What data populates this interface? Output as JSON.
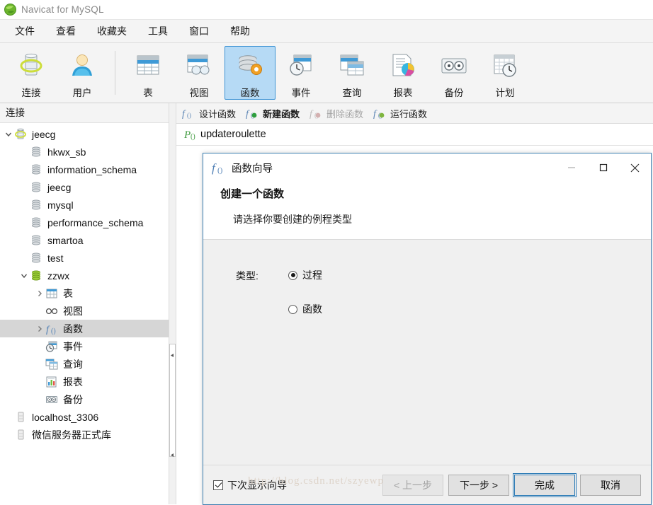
{
  "window": {
    "title": "Navicat for MySQL",
    "logo_icon": "navicat-globe-icon"
  },
  "menubar": {
    "items": [
      {
        "label": "文件",
        "name": "menu-file"
      },
      {
        "label": "查看",
        "name": "menu-view"
      },
      {
        "label": "收藏夹",
        "name": "menu-favorites"
      },
      {
        "label": "工具",
        "name": "menu-tools"
      },
      {
        "label": "窗口",
        "name": "menu-window"
      },
      {
        "label": "帮助",
        "name": "menu-help"
      }
    ]
  },
  "toolbar": {
    "buttons": [
      {
        "label": "连接",
        "icon": "connection-icon",
        "active": false
      },
      {
        "label": "用户",
        "icon": "user-icon",
        "active": false
      },
      {
        "label": "表",
        "icon": "table-icon",
        "active": false
      },
      {
        "label": "视图",
        "icon": "view-icon",
        "active": false
      },
      {
        "label": "函数",
        "icon": "function-icon",
        "active": true
      },
      {
        "label": "事件",
        "icon": "event-icon",
        "active": false
      },
      {
        "label": "查询",
        "icon": "query-icon",
        "active": false
      },
      {
        "label": "报表",
        "icon": "report-icon",
        "active": false
      },
      {
        "label": "备份",
        "icon": "backup-icon",
        "active": false
      },
      {
        "label": "计划",
        "icon": "schedule-icon",
        "active": false
      }
    ]
  },
  "sidebar": {
    "header": "连接",
    "tree": [
      {
        "label": "jeecg",
        "icon": "connection-icon",
        "indent": 0,
        "chevron": "down",
        "selected": false
      },
      {
        "label": "hkwx_sb",
        "icon": "database-icon",
        "indent": 1,
        "chevron": "",
        "selected": false
      },
      {
        "label": "information_schema",
        "icon": "database-icon",
        "indent": 1,
        "chevron": "",
        "selected": false
      },
      {
        "label": "jeecg",
        "icon": "database-icon",
        "indent": 1,
        "chevron": "",
        "selected": false
      },
      {
        "label": "mysql",
        "icon": "database-icon",
        "indent": 1,
        "chevron": "",
        "selected": false
      },
      {
        "label": "performance_schema",
        "icon": "database-icon",
        "indent": 1,
        "chevron": "",
        "selected": false
      },
      {
        "label": "smartoa",
        "icon": "database-icon",
        "indent": 1,
        "chevron": "",
        "selected": false
      },
      {
        "label": "test",
        "icon": "database-icon",
        "indent": 1,
        "chevron": "",
        "selected": false
      },
      {
        "label": "zzwx",
        "icon": "database-open-icon",
        "indent": 1,
        "chevron": "down",
        "selected": false
      },
      {
        "label": "表",
        "icon": "table-icon",
        "indent": 2,
        "chevron": "right",
        "selected": false
      },
      {
        "label": "视图",
        "icon": "view-glasses-icon",
        "indent": 2,
        "chevron": "",
        "selected": false
      },
      {
        "label": "函数",
        "icon": "function-fx-icon",
        "indent": 2,
        "chevron": "right",
        "selected": true
      },
      {
        "label": "事件",
        "icon": "event-icon",
        "indent": 2,
        "chevron": "",
        "selected": false
      },
      {
        "label": "查询",
        "icon": "query-icon",
        "indent": 2,
        "chevron": "",
        "selected": false
      },
      {
        "label": "报表",
        "icon": "report-icon",
        "indent": 2,
        "chevron": "",
        "selected": false
      },
      {
        "label": "备份",
        "icon": "backup-icon",
        "indent": 2,
        "chevron": "",
        "selected": false
      },
      {
        "label": "localhost_3306",
        "icon": "connection-offline-icon",
        "indent": 0,
        "chevron": "",
        "selected": false
      },
      {
        "label": "微信服务器正式库",
        "icon": "connection-offline-icon",
        "indent": 0,
        "chevron": "",
        "selected": false
      }
    ]
  },
  "content": {
    "object_tab": {
      "label": "updateroulette",
      "icon": "procedure-icon"
    },
    "actions": [
      {
        "label": "设计函数",
        "icon": "design-function-icon",
        "state": "normal"
      },
      {
        "label": "新建函数",
        "icon": "new-function-icon",
        "state": "strong"
      },
      {
        "label": "删除函数",
        "icon": "delete-function-icon",
        "state": "disabled"
      },
      {
        "label": "运行函数",
        "icon": "run-function-icon",
        "state": "normal"
      }
    ]
  },
  "dialog": {
    "title": "函数向导",
    "title_icon": "function-fx-icon",
    "heading": "创建一个函数",
    "subheading": "请选择你要创建的例程类型",
    "window_controls": {
      "minimize": "minimize-icon",
      "maximize": "maximize-icon",
      "close": "close-icon"
    },
    "form": {
      "type_label": "类型:",
      "options": [
        {
          "label": "过程",
          "selected": true
        },
        {
          "label": "函数",
          "selected": false
        }
      ]
    },
    "footer": {
      "checkbox_label": "下次显示向导",
      "checkbox_checked": true,
      "buttons": [
        {
          "label": "< 上一步",
          "state": "disabled",
          "name": "back-button"
        },
        {
          "label": "下一步 >",
          "state": "normal",
          "name": "next-button"
        },
        {
          "label": "完成",
          "state": "default",
          "name": "finish-button"
        },
        {
          "label": "取消",
          "state": "normal",
          "name": "cancel-button"
        }
      ]
    }
  },
  "watermark": "http://blog.csdn.net/szyewp",
  "colors": {
    "accent_blue": "#3c7fb1",
    "toolbar_active_bg": "#b6daf5",
    "tree_selected_bg": "#d6d6d6",
    "chrome_bg": "#f4f4f4",
    "dialog_body": "#f0f0f0"
  }
}
